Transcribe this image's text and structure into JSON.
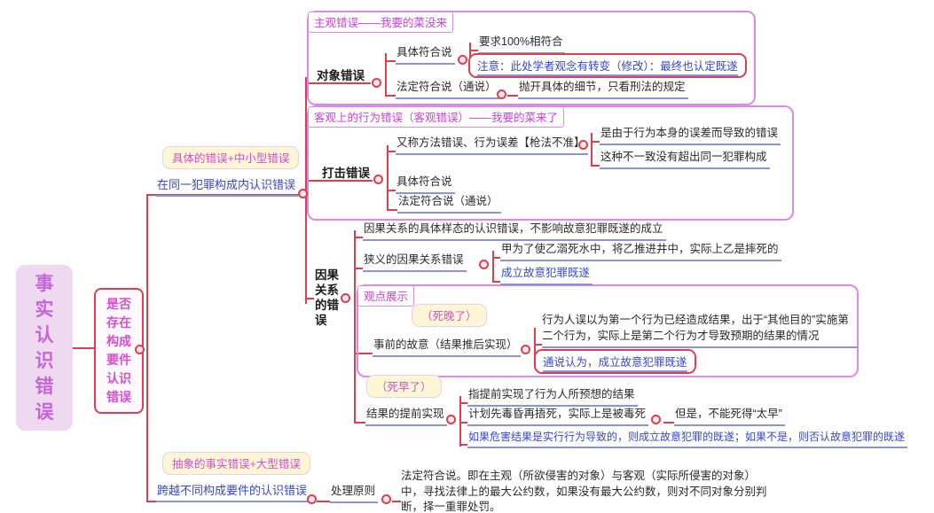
{
  "root": {
    "label": "事实认识错误"
  },
  "level2": {
    "label": "是否存在构成要件认识错误"
  },
  "branch_same": {
    "callout": "具体的错误+中小型错误",
    "label": "在同一犯罪构成内认识错误"
  },
  "object_error": {
    "boundary_title": "主观错误——我要的菜没来",
    "topic": "对象错误",
    "concrete_label": "具体符合说",
    "concrete_req": "要求100%相符合",
    "concrete_note": "注意：此处学者观念有转变（修改）：最终也认定既遂",
    "legal_label": "法定符合说（通说）",
    "legal_detail": "抛开具体的细节，只看刑法的规定"
  },
  "strike_error": {
    "boundary_title": "客观上的行为错误（客观错误）——我要的菜来了",
    "topic": "打击错误",
    "alias_label": "又称方法错误、行为误差【枪法不准】",
    "alias_cause": "是由于行为本身的误差而导致的错误",
    "alias_scope": "这种不一致没有超出同一犯罪构成",
    "concrete_label": "具体符合说",
    "legal_label": "法定符合说（通说）"
  },
  "causation_error": {
    "topic": "因果关系的错误",
    "general": "因果关系的具体样态的认识错误，不影响故意犯罪既遂的成立",
    "narrow_label": "狭义的因果关系错误",
    "narrow_example": "甲为了使乙溺死水中，将乙推进井中，实际上乙是摔死的",
    "narrow_conclusion": "成立故意犯罪既遂",
    "viewpoint_title": "观点展示",
    "advance_callout": "（死晚了）",
    "advance_label": "事前的故意（结果推后实现）",
    "advance_desc": "行为人误以为第一个行为已经造成结果，出于“其他目的”实施第二个行为，实际上是第二个行为才导致预期的结果的情况",
    "advance_conclusion": "通说认为，成立故意犯罪既遂",
    "early_callout": "（死早了）",
    "early_label": "结果的提前实现",
    "early_def": "指提前实现了行为人所预想的结果",
    "early_example": "计划先毒昏再捂死，实际上是被毒死",
    "early_but": "但是，不能死得“太早”",
    "early_rule": "如果危害结果是实行行为导致的，则成立故意犯罪的既遂；如果不是，则否认故意犯罪的既遂"
  },
  "branch_cross": {
    "callout": "抽象的事实错误+大型错误",
    "label": "跨越不同构成要件的认识错误",
    "principle_label": "处理原则",
    "principle_detail": "法定符合说。即在主观（所欲侵害的对象）与客观（实际所侵害的对象）中，寻找法律上的最大公约数，如果没有最大公约数，则对不同对象分别判断，择一重罪处罚。"
  },
  "colors": {
    "connector_red": "#e03e50",
    "boundary_magenta": "#dc8ae8",
    "text_blue": "#3547d0",
    "text_magenta": "#cf3fd8",
    "underline_blue": "#8a93d6",
    "callout_bg": "#fdf6d4",
    "root_bg": "#eed9f0"
  }
}
